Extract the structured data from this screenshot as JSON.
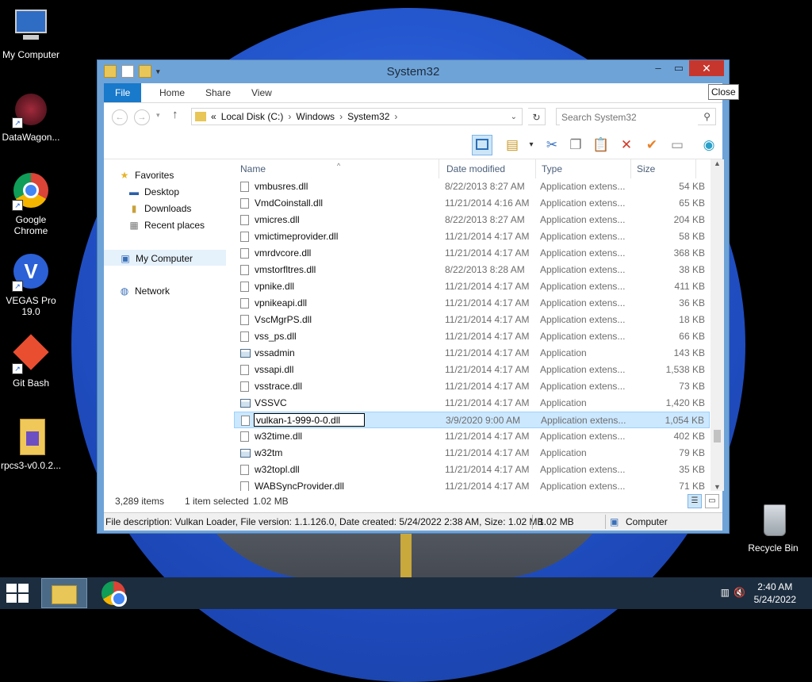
{
  "desktop": {
    "icons": [
      {
        "label": "My Computer"
      },
      {
        "label": "DataWagon..."
      },
      {
        "label": "Google Chrome"
      },
      {
        "label": "VEGAS Pro 19.0"
      },
      {
        "label": "Git Bash"
      },
      {
        "label": "rpcs3-v0.0.2..."
      },
      {
        "label": "Recycle Bin"
      }
    ]
  },
  "window": {
    "title": "System32",
    "close_tooltip": "Close",
    "tabs": [
      "File",
      "Home",
      "Share",
      "View"
    ],
    "address": {
      "prefix": "«",
      "crumbs": [
        "Local Disk (C:)",
        "Windows",
        "System32"
      ]
    },
    "search_placeholder": "Search System32",
    "nav": {
      "favorites": "Favorites",
      "desktop": "Desktop",
      "downloads": "Downloads",
      "recent": "Recent places",
      "computer": "My Computer",
      "network": "Network"
    },
    "columns": {
      "name": "Name",
      "date": "Date modified",
      "type": "Type",
      "size": "Size"
    },
    "files": [
      {
        "name": "vmbusres.dll",
        "date": "8/22/2013 8:27 AM",
        "type": "Application extens...",
        "size": "54 KB",
        "kind": "dll"
      },
      {
        "name": "VmdCoinstall.dll",
        "date": "11/21/2014 4:16 AM",
        "type": "Application extens...",
        "size": "65 KB",
        "kind": "dll"
      },
      {
        "name": "vmicres.dll",
        "date": "8/22/2013 8:27 AM",
        "type": "Application extens...",
        "size": "204 KB",
        "kind": "dll"
      },
      {
        "name": "vmictimeprovider.dll",
        "date": "11/21/2014 4:17 AM",
        "type": "Application extens...",
        "size": "58 KB",
        "kind": "dll"
      },
      {
        "name": "vmrdvcore.dll",
        "date": "11/21/2014 4:17 AM",
        "type": "Application extens...",
        "size": "368 KB",
        "kind": "dll"
      },
      {
        "name": "vmstorfltres.dll",
        "date": "8/22/2013 8:28 AM",
        "type": "Application extens...",
        "size": "38 KB",
        "kind": "dll"
      },
      {
        "name": "vpnike.dll",
        "date": "11/21/2014 4:17 AM",
        "type": "Application extens...",
        "size": "411 KB",
        "kind": "dll"
      },
      {
        "name": "vpnikeapi.dll",
        "date": "11/21/2014 4:17 AM",
        "type": "Application extens...",
        "size": "36 KB",
        "kind": "dll"
      },
      {
        "name": "VscMgrPS.dll",
        "date": "11/21/2014 4:17 AM",
        "type": "Application extens...",
        "size": "18 KB",
        "kind": "dll"
      },
      {
        "name": "vss_ps.dll",
        "date": "11/21/2014 4:17 AM",
        "type": "Application extens...",
        "size": "66 KB",
        "kind": "dll"
      },
      {
        "name": "vssadmin",
        "date": "11/21/2014 4:17 AM",
        "type": "Application",
        "size": "143 KB",
        "kind": "app"
      },
      {
        "name": "vssapi.dll",
        "date": "11/21/2014 4:17 AM",
        "type": "Application extens...",
        "size": "1,538 KB",
        "kind": "dll"
      },
      {
        "name": "vsstrace.dll",
        "date": "11/21/2014 4:17 AM",
        "type": "Application extens...",
        "size": "73 KB",
        "kind": "dll"
      },
      {
        "name": "VSSVC",
        "date": "11/21/2014 4:17 AM",
        "type": "Application",
        "size": "1,420 KB",
        "kind": "app"
      },
      {
        "name": "vulkan-1-999-0-0.dll",
        "date": "3/9/2020 9:00 AM",
        "type": "Application extens...",
        "size": "1,054 KB",
        "kind": "dll",
        "selected": true
      },
      {
        "name": "w32time.dll",
        "date": "11/21/2014 4:17 AM",
        "type": "Application extens...",
        "size": "402 KB",
        "kind": "dll"
      },
      {
        "name": "w32tm",
        "date": "11/21/2014 4:17 AM",
        "type": "Application",
        "size": "79 KB",
        "kind": "app"
      },
      {
        "name": "w32topl.dll",
        "date": "11/21/2014 4:17 AM",
        "type": "Application extens...",
        "size": "35 KB",
        "kind": "dll"
      },
      {
        "name": "WABSyncProvider.dll",
        "date": "11/21/2014 4:17 AM",
        "type": "Application extens...",
        "size": "71 KB",
        "kind": "dll"
      }
    ],
    "status": {
      "count": "3,289 items",
      "selected": "1 item selected",
      "size": "1.02 MB"
    },
    "info": {
      "description": "File description: Vulkan Loader, File version: 1.1.126.0, Date created: 5/24/2022 2:38 AM, Size: 1.02 MB",
      "size": "1.02 MB",
      "location": "Computer"
    }
  },
  "taskbar": {
    "time": "2:40 AM",
    "date": "5/24/2022"
  },
  "colors": {
    "accent": "#1979ca",
    "selection": "#cce8ff",
    "close": "#c7362d",
    "taskbar": "#1c2d3f"
  }
}
